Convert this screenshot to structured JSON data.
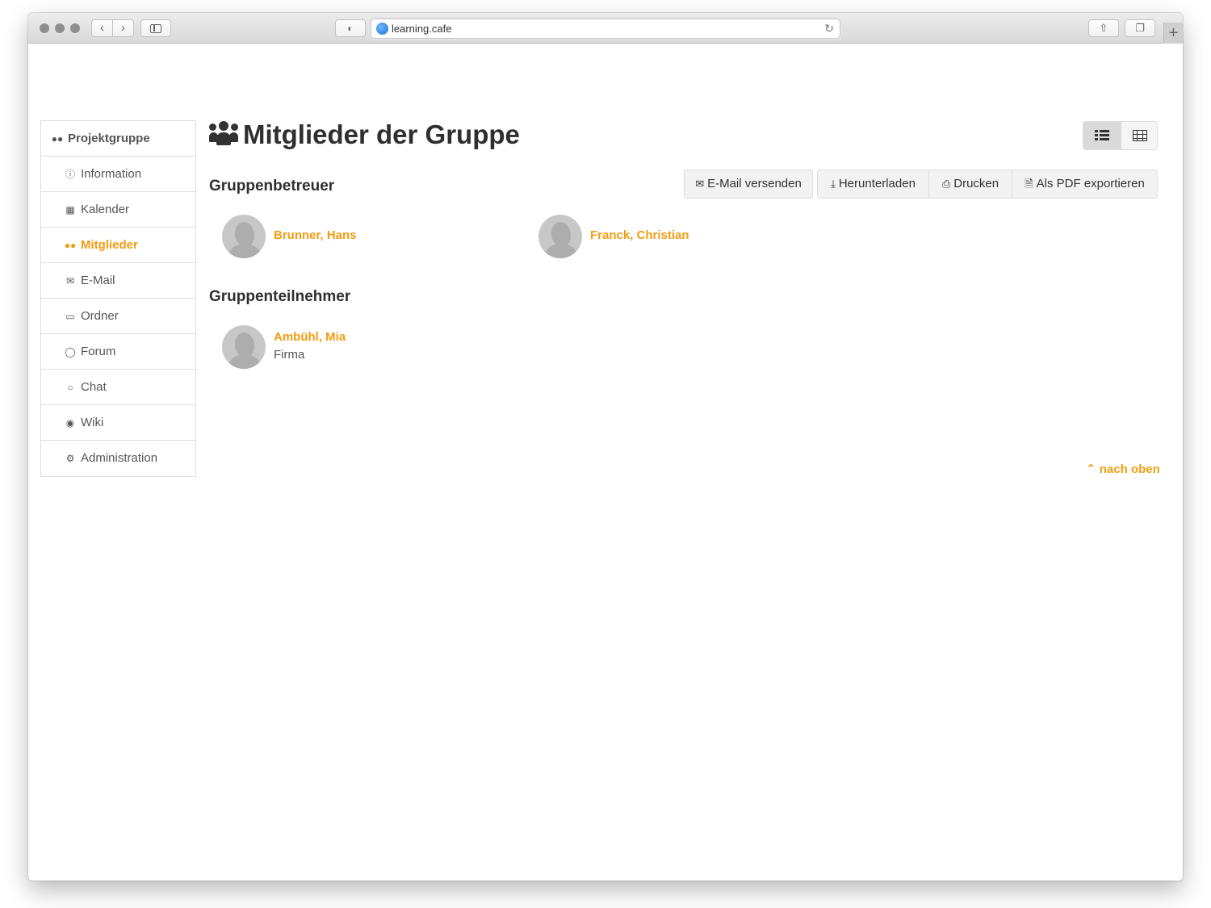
{
  "browser": {
    "url": "learning.cafe",
    "new_tab_label": "+"
  },
  "sidebar": {
    "header": "Projektgruppe",
    "items": [
      {
        "label": "Information",
        "icon": "info-circle-icon"
      },
      {
        "label": "Kalender",
        "icon": "calendar-icon"
      },
      {
        "label": "Mitglieder",
        "icon": "users-icon",
        "active": true
      },
      {
        "label": "E-Mail",
        "icon": "envelope-icon"
      },
      {
        "label": "Ordner",
        "icon": "folder-open-icon"
      },
      {
        "label": "Forum",
        "icon": "comments-icon"
      },
      {
        "label": "Chat",
        "icon": "comment-icon"
      },
      {
        "label": "Wiki",
        "icon": "globe-icon"
      },
      {
        "label": "Administration",
        "icon": "cogs-icon"
      }
    ]
  },
  "main": {
    "title": "Mitglieder der Gruppe",
    "view_toggle": {
      "active": "list"
    },
    "toolbar": {
      "email": "E-Mail versenden",
      "download": "Herunterladen",
      "print": "Drucken",
      "pdf": "Als PDF exportieren"
    },
    "sections": {
      "betreuer": {
        "title": "Gruppenbetreuer",
        "members": [
          {
            "name": "Brunner, Hans"
          },
          {
            "name": "Franck, Christian"
          }
        ]
      },
      "teilnehmer": {
        "title": "Gruppenteilnehmer",
        "members": [
          {
            "name": "Ambühl, Mia",
            "company": "Firma"
          }
        ]
      }
    },
    "back_to_top": "nach oben"
  },
  "colors": {
    "accent": "#f39c12",
    "text": "#333333",
    "border": "#dddddd"
  }
}
